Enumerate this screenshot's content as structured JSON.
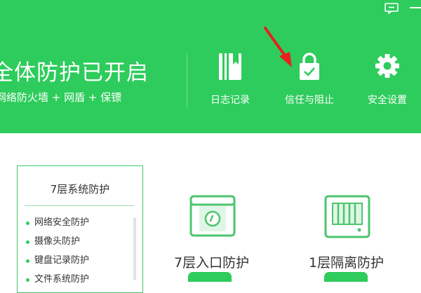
{
  "header": {
    "title": "全体防护已开启",
    "subtitle": "网络防火墙 + 网盾 + 保镖"
  },
  "toolbar": {
    "items": [
      {
        "label": "日志记录",
        "icon": "book-icon"
      },
      {
        "label": "信任与阻止",
        "icon": "lock-check-icon"
      },
      {
        "label": "安全设置",
        "icon": "gear-icon"
      }
    ]
  },
  "panel": {
    "title": "7层系统防护",
    "items": [
      {
        "label": "网络安全防护"
      },
      {
        "label": "摄像头防护"
      },
      {
        "label": "键盘记录防护"
      },
      {
        "label": "文件系统防护"
      }
    ]
  },
  "features": [
    {
      "label": "7层入口防护",
      "icon": "shield-screen-icon"
    },
    {
      "label": "1层隔离防护",
      "icon": "isolation-box-icon"
    }
  ],
  "colors": {
    "brand_green": "#2ecc5c",
    "arrow_red": "#e8211d"
  }
}
